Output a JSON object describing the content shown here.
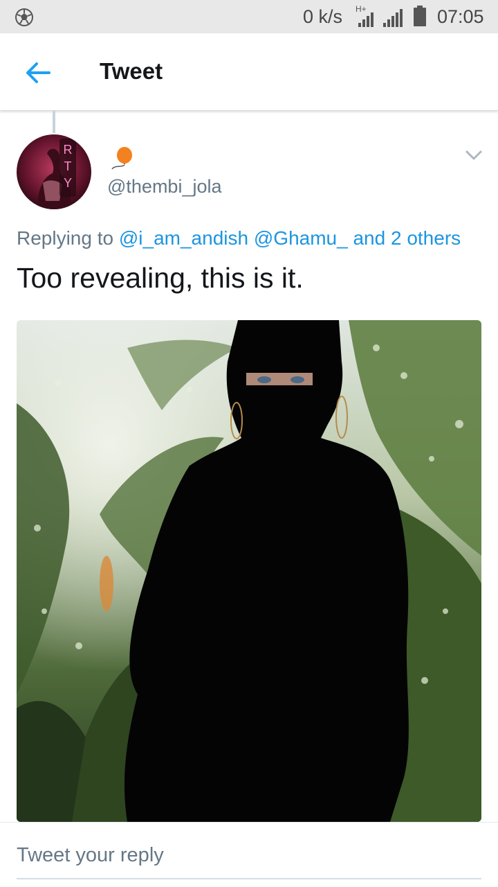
{
  "status_bar": {
    "speed": "0 k/s",
    "network_type": "H+",
    "time": "07:05",
    "left_icon": "soccer-ball-icon"
  },
  "header": {
    "title": "Tweet",
    "back_icon": "arrow-left-icon",
    "accent": "#1da1f2"
  },
  "tweet": {
    "handle": "@thembi_jola",
    "display_name_icon": "balloon-icon",
    "replying_prefix": "Replying to",
    "mentions": [
      "@i_am_andish",
      "@Ghamu_"
    ],
    "others": "and 2 others",
    "text": "Too revealing, this is it.",
    "avatar_sign_letters": [
      "R",
      "T",
      "Y"
    ]
  },
  "reply_bar": {
    "placeholder": "Tweet your reply"
  },
  "colors": {
    "mention": "#1b95e0",
    "secondary_text": "#657786",
    "primary_text": "#14171a"
  }
}
